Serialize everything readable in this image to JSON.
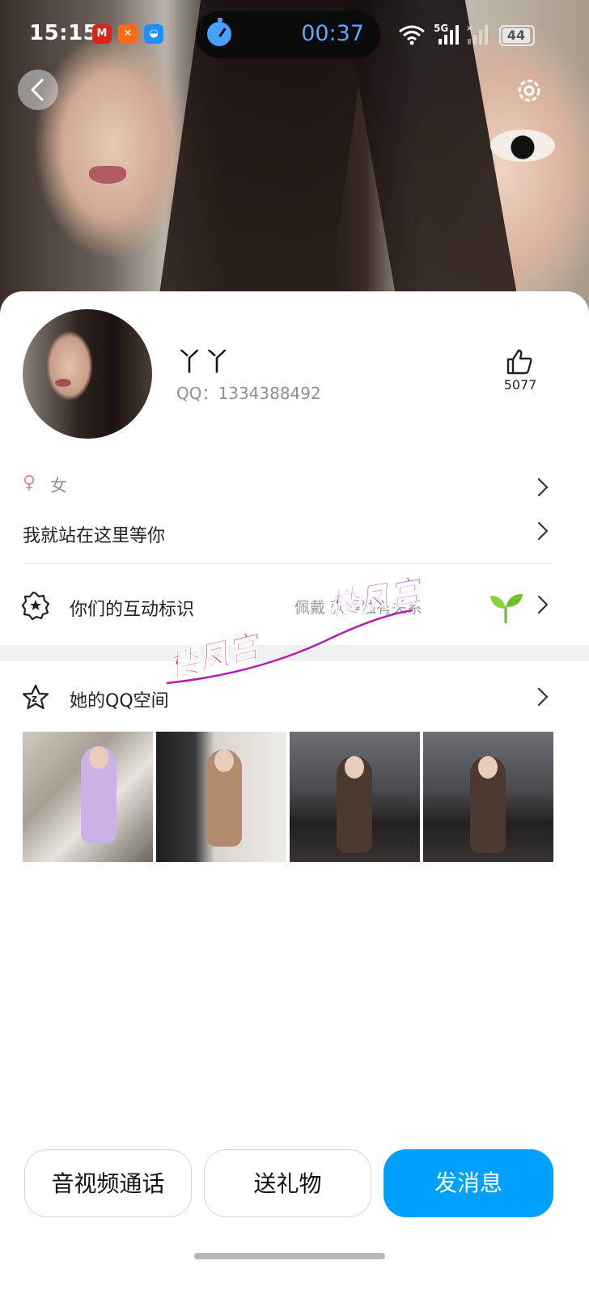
{
  "status_bar": {
    "time": "15:15",
    "timer": "00:37",
    "network": "5G",
    "battery": "44"
  },
  "profile": {
    "nickname": "丫丫",
    "qq_label": "QQ：1334388492",
    "likes": "5077"
  },
  "info_rows": {
    "gender_symbol": "♀",
    "gender": "女",
    "signature": "我就站在这里等你",
    "interaction_label": "你们的互动标识",
    "interaction_hint": "佩戴       获得独有关系",
    "qzone_label": "她的QQ空间"
  },
  "watermark": {
    "text_1": "楼凤宫",
    "text_2": "楼凤宫"
  },
  "actions": {
    "call": "音视频通话",
    "gift": "送礼物",
    "message": "发消息"
  },
  "colors": {
    "primary": "#00a0ff",
    "gender_icon": "#ea7fb4"
  }
}
